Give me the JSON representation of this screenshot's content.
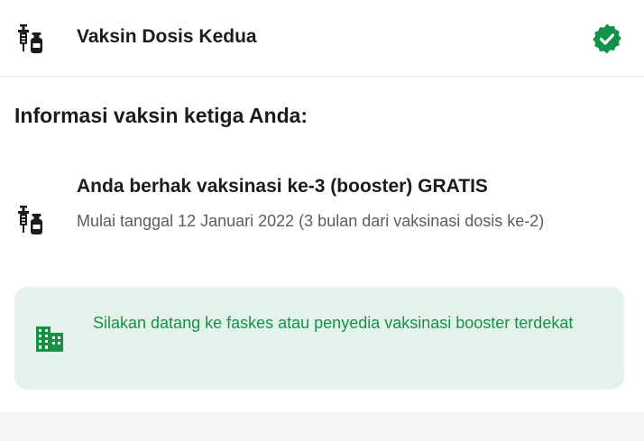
{
  "colors": {
    "accent_green": "#159246",
    "info_bg": "#e5f2ec",
    "badge_green": "#12914a"
  },
  "icons": {
    "dose": "vaccine-icon",
    "status": "verified-check-icon",
    "booster": "vaccine-icon",
    "facility": "building-icon"
  },
  "second_dose": {
    "title": "Vaksin Dosis Kedua"
  },
  "third_dose": {
    "section_title": "Informasi vaksin ketiga Anda:",
    "eligibility_title": "Anda berhak vaksinasi ke-3 (booster) GRATIS",
    "eligibility_detail": "Mulai tanggal 12 Januari 2022 (3 bulan dari vaksinasi dosis ke-2)",
    "info_message": "Silakan datang ke faskes atau penyedia vaksinasi booster terdekat"
  }
}
